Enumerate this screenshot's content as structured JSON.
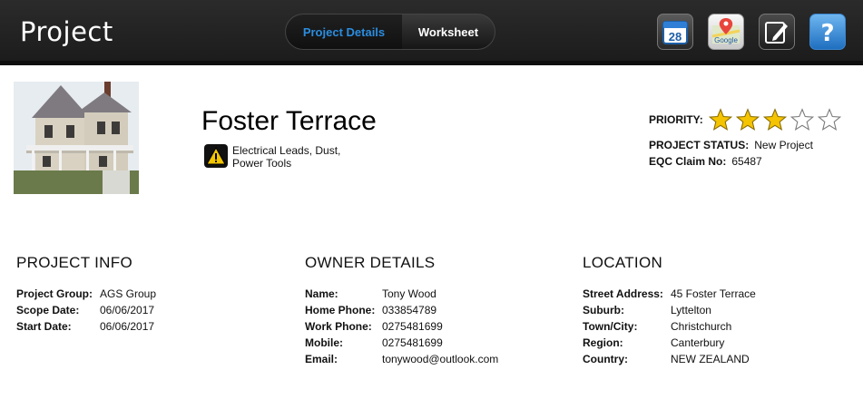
{
  "header": {
    "title": "Project",
    "tabs": [
      {
        "label": "Project Details",
        "active": true
      },
      {
        "label": "Worksheet",
        "active": false
      }
    ],
    "calendar_day": "28",
    "google_label": "Google",
    "help_glyph": "?",
    "icons": [
      "calendar-icon",
      "google-maps-icon",
      "edit-pencil-icon",
      "help-icon"
    ]
  },
  "project": {
    "name": "Foster Terrace",
    "hazards": "Electrical Leads, Dust, Power Tools",
    "priority_label": "PRIORITY:",
    "priority_value": 3,
    "priority_max": 5,
    "status_label": "PROJECT STATUS:",
    "status_value": "New Project",
    "claim_label": "EQC Claim No:",
    "claim_value": "65487"
  },
  "project_info": {
    "title": "PROJECT INFO",
    "rows": [
      {
        "label": "Project Group:",
        "value": "AGS Group"
      },
      {
        "label": "Scope Date:",
        "value": "06/06/2017"
      },
      {
        "label": "Start Date:",
        "value": "06/06/2017"
      }
    ]
  },
  "owner": {
    "title": "OWNER DETAILS",
    "rows": [
      {
        "label": "Name:",
        "value": "Tony Wood"
      },
      {
        "label": "Home Phone:",
        "value": "033854789"
      },
      {
        "label": "Work Phone:",
        "value": "0275481699"
      },
      {
        "label": "Mobile:",
        "value": "0275481699"
      },
      {
        "label": "Email:",
        "value": "tonywood@outlook.com"
      }
    ]
  },
  "location": {
    "title": "LOCATION",
    "rows": [
      {
        "label": "Street Address:",
        "value": "45 Foster Terrace"
      },
      {
        "label": "Suburb:",
        "value": "Lyttelton"
      },
      {
        "label": "Town/City:",
        "value": "Christchurch"
      },
      {
        "label": "Region:",
        "value": "Canterbury"
      },
      {
        "label": "Country:",
        "value": "NEW ZEALAND"
      }
    ]
  },
  "colors": {
    "header_bg": "#1c1c1c",
    "active_tab": "#2a8de0",
    "star_fill": "#f5c400",
    "star_empty": "#ffffff"
  }
}
